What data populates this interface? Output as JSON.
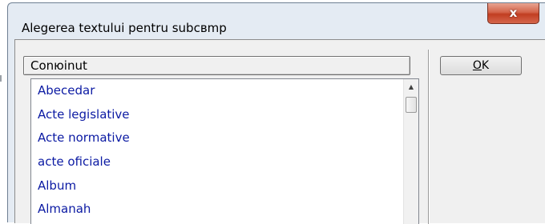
{
  "window": {
    "title": "Alegerea textului pentru subcвmp",
    "close_label": "x"
  },
  "header": {
    "column_label": "Conюinut"
  },
  "list": {
    "items": [
      "Abecedar",
      "Acte legislative",
      "Acte normative",
      "acte oficiale",
      "Album",
      "Almanah"
    ]
  },
  "scrollbar": {
    "up_arrow_icon": "triangle-up"
  },
  "buttons": {
    "ok_mnemonic": "O",
    "ok_rest": "K"
  },
  "colors": {
    "list_text": "#0b1aa3",
    "close_button": "#c13e22",
    "frame": "#e4ebf3"
  }
}
